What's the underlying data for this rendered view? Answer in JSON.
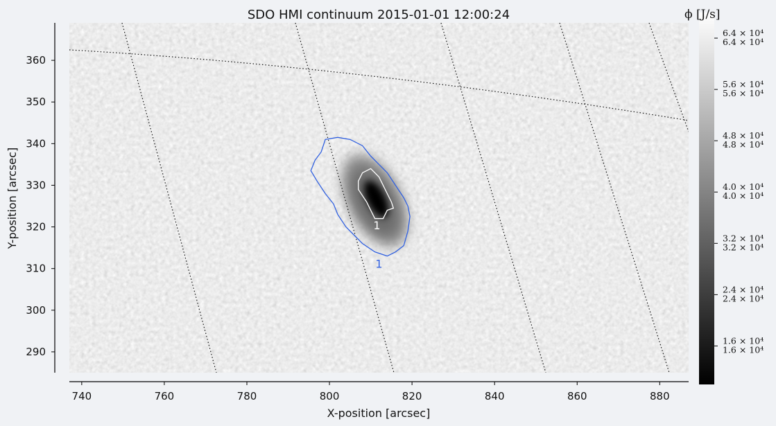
{
  "chart_data": {
    "type": "heatmap",
    "title": "SDO HMI continuum 2015-01-01 12:00:24",
    "xlabel": "X-position [arcsec]",
    "ylabel": "Y-position [arcsec]",
    "xlim": [
      737,
      887
    ],
    "ylim": [
      285,
      369
    ],
    "x_ticks": [
      740,
      760,
      780,
      800,
      820,
      840,
      860,
      880
    ],
    "y_ticks": [
      290,
      300,
      310,
      320,
      330,
      340,
      350,
      360
    ],
    "grid": true,
    "colormap": "gray",
    "colorbar": {
      "label": "ϕ [J/s]",
      "tick_values": [
        16000,
        24000,
        32000,
        40000,
        48000,
        56000,
        64000
      ],
      "tick_labels": [
        "1.6 × 10⁴",
        "2.4 × 10⁴",
        "3.2 × 10⁴",
        "4.0 × 10⁴",
        "4.8 × 10⁴",
        "5.6 × 10⁴",
        "6.4 × 10⁴"
      ],
      "range": [
        10000,
        68000
      ]
    },
    "features": {
      "sunspot_center": [
        811,
        327
      ],
      "umbra_contour": {
        "label": "1",
        "color": "#ffffff",
        "points": [
          [
            808,
            333
          ],
          [
            810,
            334
          ],
          [
            812,
            332
          ],
          [
            813,
            330
          ],
          [
            814,
            328
          ],
          [
            815,
            326
          ],
          [
            815.5,
            324.5
          ],
          [
            814,
            324
          ],
          [
            813,
            322
          ],
          [
            811,
            322
          ],
          [
            810,
            324
          ],
          [
            809,
            326
          ],
          [
            807,
            329
          ],
          [
            807,
            331
          ]
        ]
      },
      "penumbra_contour": {
        "label": "1",
        "color": "#3060e0",
        "points": [
          [
            799,
            341
          ],
          [
            802,
            341.5
          ],
          [
            805,
            341
          ],
          [
            808,
            339.5
          ],
          [
            810,
            337
          ],
          [
            812,
            335
          ],
          [
            814,
            333
          ],
          [
            816,
            330
          ],
          [
            818,
            327
          ],
          [
            819,
            325
          ],
          [
            819.5,
            322.5
          ],
          [
            819,
            319
          ],
          [
            818,
            315.5
          ],
          [
            816,
            314
          ],
          [
            814,
            313
          ],
          [
            811,
            314
          ],
          [
            808,
            316
          ],
          [
            806,
            318
          ],
          [
            804,
            320
          ],
          [
            802,
            323
          ],
          [
            801,
            325.5
          ],
          [
            799,
            328
          ],
          [
            797,
            331
          ],
          [
            795.5,
            333.5
          ],
          [
            796.5,
            336
          ],
          [
            798,
            338
          ]
        ]
      }
    }
  }
}
